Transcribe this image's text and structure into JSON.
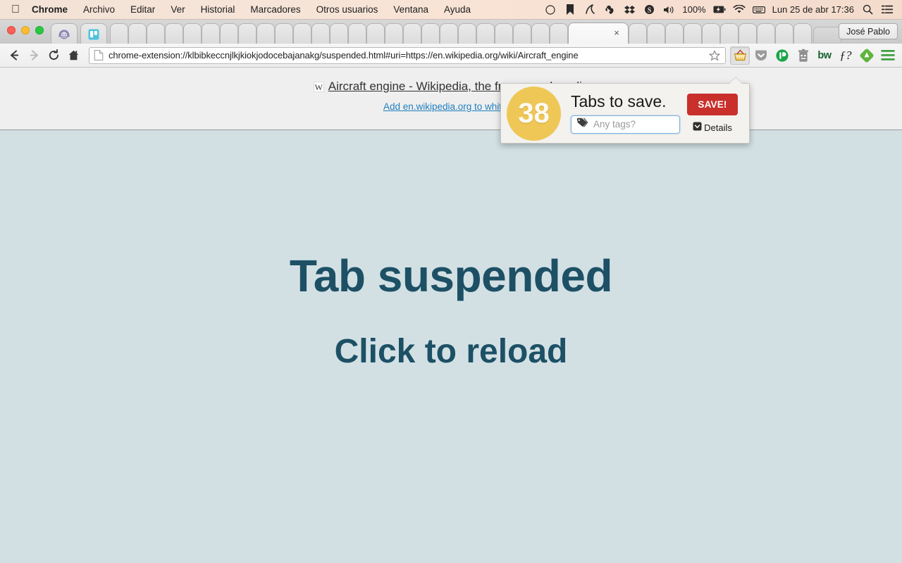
{
  "menubar": {
    "apple_icon": "apple-logo-icon",
    "items": [
      {
        "label": "Chrome",
        "bold": true
      },
      {
        "label": "Archivo",
        "bold": false
      },
      {
        "label": "Editar",
        "bold": false
      },
      {
        "label": "Ver",
        "bold": false
      },
      {
        "label": "Historial",
        "bold": false
      },
      {
        "label": "Marcadores",
        "bold": false
      },
      {
        "label": "Otros usuarios",
        "bold": false
      },
      {
        "label": "Ventana",
        "bold": false
      },
      {
        "label": "Ayuda",
        "bold": false
      }
    ],
    "status_icons": [
      "circle-outline-icon",
      "bookmark-icon",
      "rescuetime-icon",
      "evernote-elephant-icon",
      "dropbox-icon",
      "skitch-icon",
      "volume-icon"
    ],
    "battery_percent": "100%",
    "battery_icon": "battery-charging-icon",
    "wifi_icon": "wifi-icon",
    "keyboard_icon": "keyboard-icon",
    "clock": "Lun 25 de abr  17:36",
    "date_text": "Lun 25 de abr",
    "time_text": "17:36",
    "search_icon": "spotlight-search-icon",
    "notifications_icon": "notification-center-icon"
  },
  "window": {
    "profile_name": "José Pablo",
    "traffic_lights": [
      "close",
      "minimize",
      "zoom"
    ],
    "pinned_tabs": [
      {
        "favicon": "headphones-smiley-icon",
        "color": "#8d84b8"
      },
      {
        "favicon": "trello-icon",
        "color": "#4fc3dd"
      }
    ],
    "active_tab": {
      "title": "",
      "close_label": "×"
    },
    "new_tab_label": ""
  },
  "toolbar": {
    "back_icon": "back-arrow-icon",
    "forward_icon": "forward-arrow-icon",
    "reload_icon": "reload-icon",
    "home_icon": "home-icon",
    "page_icon": "page-document-icon",
    "url": "chrome-extension://klbibkeccnjlkjkiokjodocebajanakg/suspended.html#uri=https://en.wikipedia.org/wiki/Aircraft_engine",
    "star_icon": "bookmark-star-icon",
    "extensions": [
      {
        "name": "basket-icon",
        "label": "",
        "active": true
      },
      {
        "name": "pocket-icon",
        "label": "",
        "active": false
      },
      {
        "name": "onepassword-icon",
        "label": "",
        "active": false
      },
      {
        "name": "trash-ghost-icon",
        "label": "",
        "active": false
      },
      {
        "name": "bitwarden-icon",
        "label": "bw",
        "active": false
      },
      {
        "name": "fontface-icon",
        "label": "ƒ?",
        "active": false
      },
      {
        "name": "feedly-icon",
        "label": "",
        "active": false
      }
    ],
    "menu_icon": "chrome-menu-icon"
  },
  "page": {
    "favicon": "wikipedia-w-icon",
    "title_link": "Aircraft engine - Wikipedia, the free encyclopedia",
    "whitelist_link": "Add en.wikipedia.org to whitelist",
    "heading": "Tab suspended",
    "subheading": "Click to reload",
    "bg_color": "#d2e0e4",
    "text_color": "#1d5065"
  },
  "popup": {
    "badge_count": "38",
    "badge_color": "#eec756",
    "heading": "Tabs to save.",
    "tag_icon": "tag-icon",
    "tag_placeholder": "Any tags?",
    "save_label": "SAVE!",
    "save_color": "#c9302c",
    "details_label": "Details",
    "details_icon": "chevron-down-circle-icon"
  }
}
